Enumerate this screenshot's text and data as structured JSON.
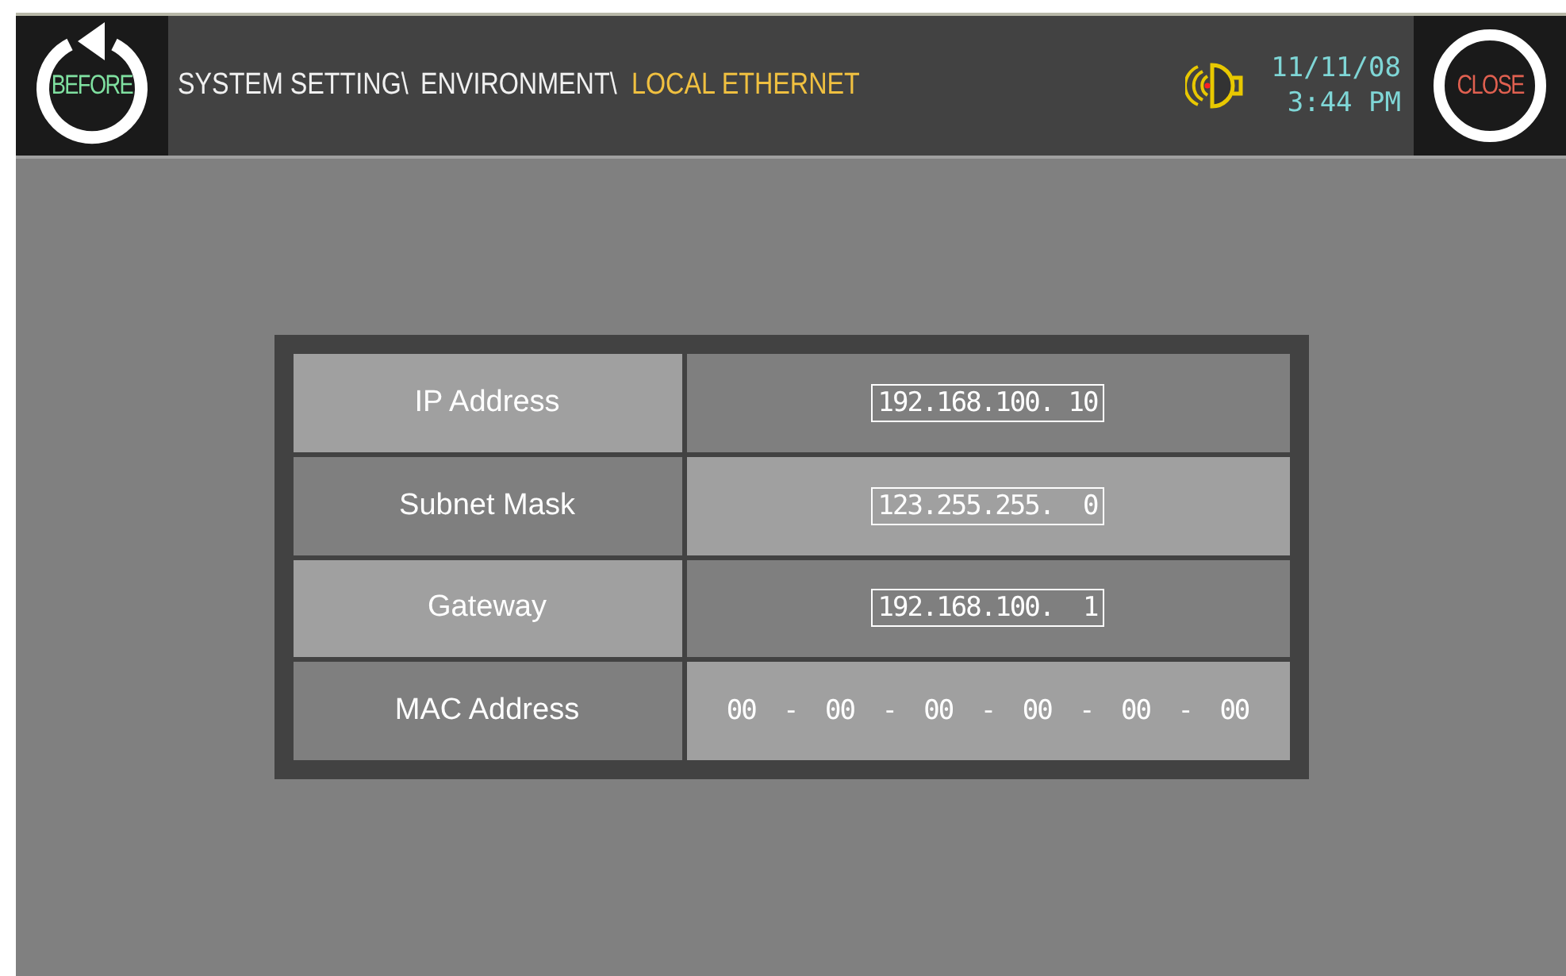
{
  "header": {
    "back_button": "BEFORE",
    "breadcrumb": [
      {
        "label": "SYSTEM SETTING\\",
        "current": false
      },
      {
        "label": "ENVIRONMENT\\",
        "current": false
      },
      {
        "label": "LOCAL ETHERNET",
        "current": true
      }
    ],
    "date": "11/11/08",
    "time": "3:44 PM",
    "close_button": "CLOSE"
  },
  "settings": [
    {
      "label": "IP Address",
      "kind": "field",
      "value": "192.168.100. 10"
    },
    {
      "label": "Subnet Mask",
      "kind": "field",
      "value": "123.255.255.  0"
    },
    {
      "label": "Gateway",
      "kind": "field",
      "value": "192.168.100.  1"
    },
    {
      "label": "MAC Address",
      "kind": "text",
      "value": "00 - 00 - 00 - 00 - 00 - 00"
    }
  ]
}
